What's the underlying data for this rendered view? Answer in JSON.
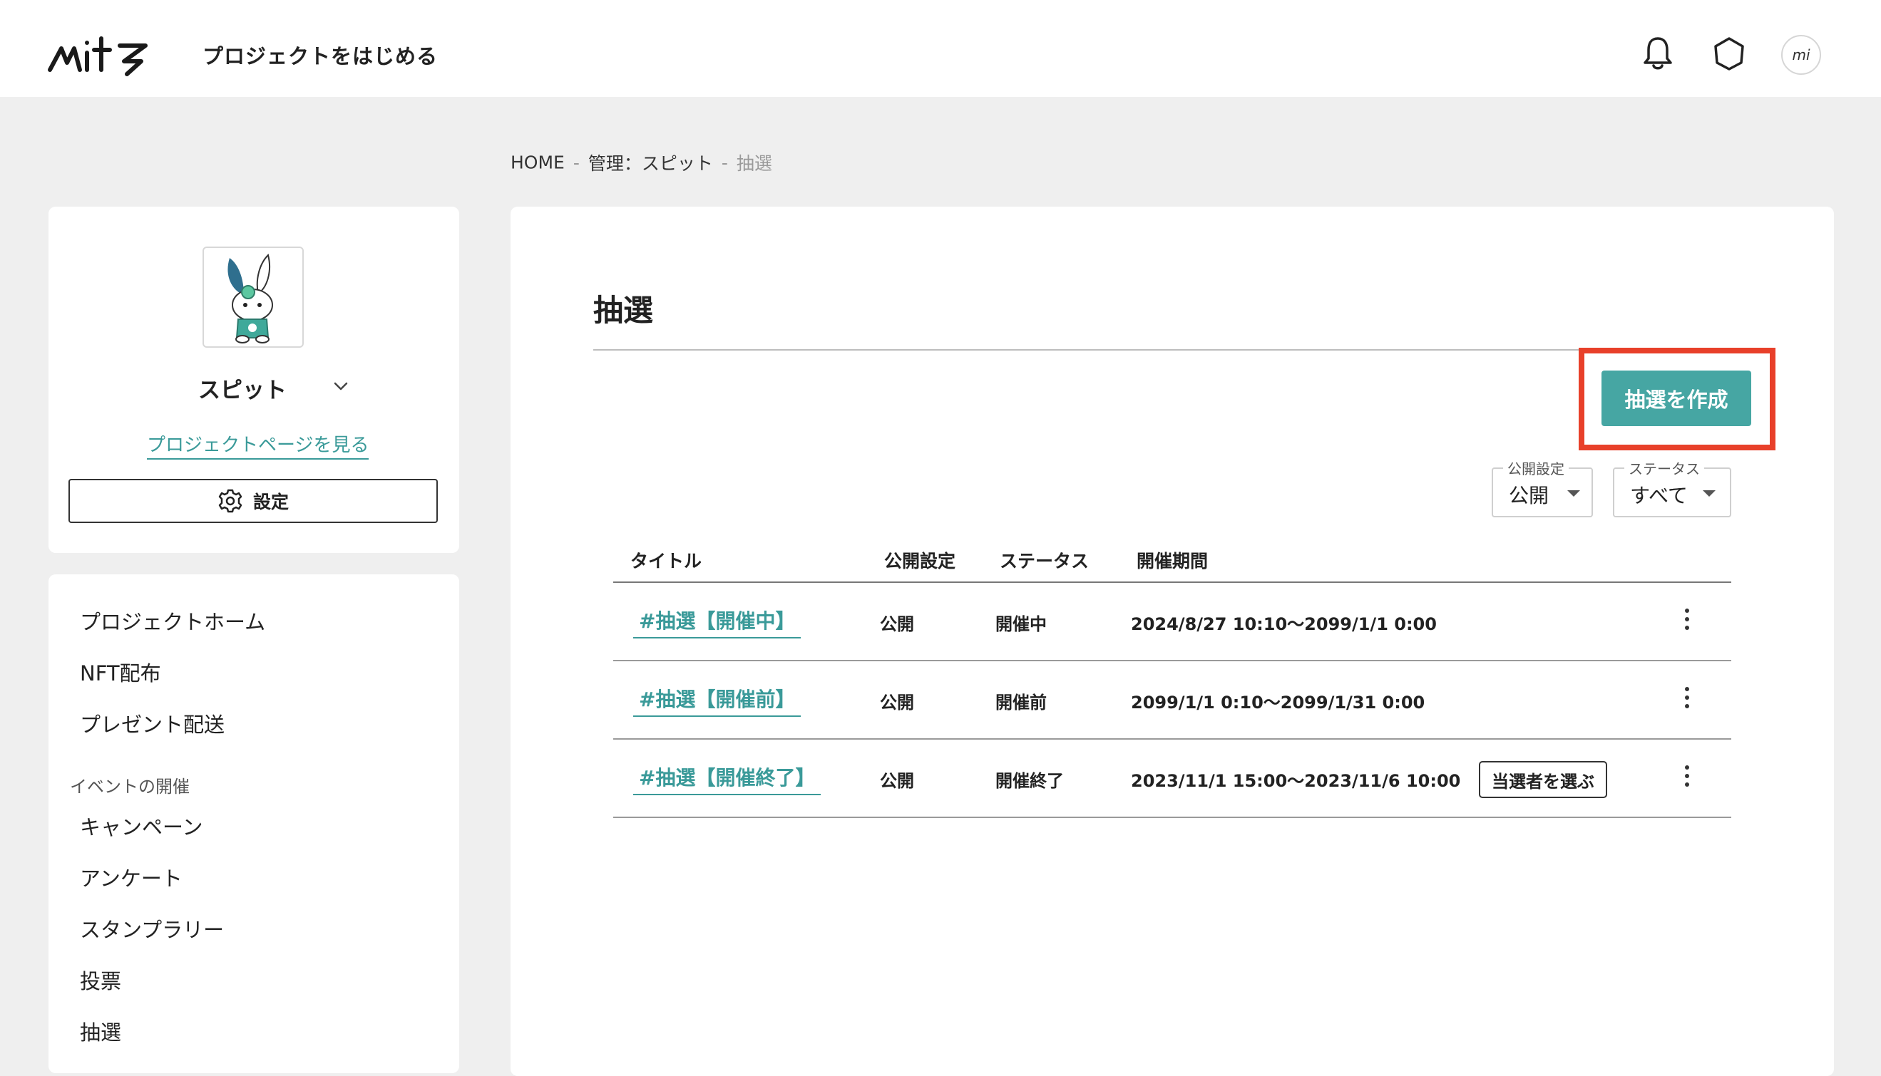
{
  "header": {
    "logo_text": "mits",
    "start_project": "プロジェクトをはじめる",
    "avatar_text": "mi"
  },
  "breadcrumb": {
    "home": "HOME",
    "sep": "-",
    "manage": "管理：スピット",
    "current": "抽選"
  },
  "project": {
    "name": "スピット",
    "page_link": "プロジェクトページを見る",
    "settings_label": "設定"
  },
  "nav": {
    "items": [
      "プロジェクトホーム",
      "NFT配布",
      "プレゼント配送"
    ],
    "section_label": "イベントの開催",
    "event_items": [
      "キャンペーン",
      "アンケート",
      "スタンプラリー",
      "投票",
      "抽選"
    ]
  },
  "main": {
    "title": "抽選",
    "create_label": "抽選を作成",
    "filters": {
      "visibility": {
        "label": "公開設定",
        "value": "公開"
      },
      "status": {
        "label": "ステータス",
        "value": "すべて"
      }
    },
    "table": {
      "headers": {
        "title": "タイトル",
        "visibility": "公開設定",
        "status": "ステータス",
        "period": "開催期間"
      },
      "rows": [
        {
          "title": "#抽選【開催中】",
          "visibility": "公開",
          "status": "開催中",
          "period": "2024/8/27 10:10〜2099/1/1 0:00",
          "action": ""
        },
        {
          "title": "#抽選【開催前】",
          "visibility": "公開",
          "status": "開催前",
          "period": "2099/1/1 0:10〜2099/1/31 0:00",
          "action": ""
        },
        {
          "title": "#抽選【開催終了】",
          "visibility": "公開",
          "status": "開催終了",
          "period": "2023/11/1 15:00〜2023/11/6 10:00",
          "action": "当選者を選ぶ"
        }
      ]
    }
  },
  "colors": {
    "accent": "#46a6a3",
    "link": "#3a9a99",
    "highlight": "#e8402a",
    "background": "#efefef"
  },
  "icons": {
    "notification": "bell-icon",
    "hexagon": "hexagon-icon",
    "settings": "gear-icon",
    "chevron": "chevron-down-icon",
    "row_menu": "kebab-menu-icon"
  }
}
